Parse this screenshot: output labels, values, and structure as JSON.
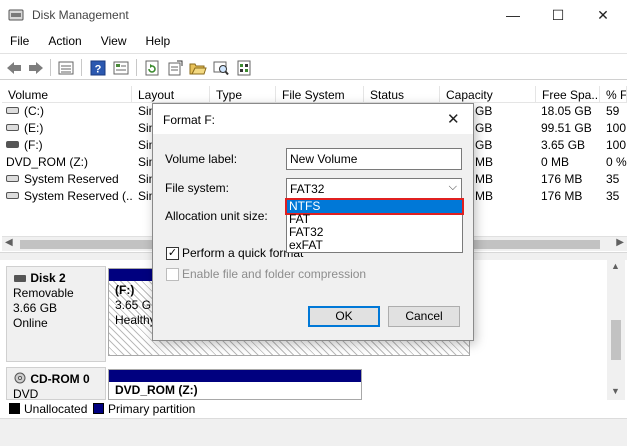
{
  "window": {
    "title": "Disk Management",
    "minimize_glyph": "—",
    "maximize_glyph": "☐",
    "close_glyph": "✕"
  },
  "menu": [
    "File",
    "Action",
    "View",
    "Help"
  ],
  "toolbar_icons": [
    "back-arrow-icon",
    "forward-arrow-icon",
    "disk-list-icon",
    "help-icon",
    "properties-icon",
    "refresh-icon",
    "rescan-icon",
    "open-folder-icon",
    "explore-icon",
    "settings-icon"
  ],
  "volume_list": {
    "columns": [
      "Volume",
      "Layout",
      "Type",
      "File System",
      "Status",
      "Capacity",
      "Free Spa...",
      "% F"
    ],
    "rows": [
      {
        "volume": "(C:)",
        "layout": "Sim",
        "capacity": "GB",
        "free": "18.05 GB",
        "pct": "59"
      },
      {
        "volume": "(E:)",
        "layout": "Sim",
        "capacity": "GB",
        "free": "99.51 GB",
        "pct": "100"
      },
      {
        "volume": "(F:)",
        "layout": "Sim",
        "capacity": "GB",
        "free": "3.65 GB",
        "pct": "100"
      },
      {
        "volume": "DVD_ROM (Z:)",
        "layout": "Sim",
        "capacity": "MB",
        "free": "0 MB",
        "pct": "0 %"
      },
      {
        "volume": "System Reserved",
        "layout": "Sim",
        "capacity": "MB",
        "free": "176 MB",
        "pct": "35"
      },
      {
        "volume": "System Reserved (...",
        "layout": "Sim",
        "capacity": "MB",
        "free": "176 MB",
        "pct": "35"
      }
    ]
  },
  "disks": [
    {
      "name": "Disk 2",
      "type": "Removable",
      "size": "3.66 GB",
      "status": "Online",
      "partition": {
        "label": "(F:)",
        "line2": "3.65 GB",
        "line3": "Healthy"
      }
    },
    {
      "name": "CD-ROM 0",
      "type": "DVD",
      "partition": {
        "label": "DVD_ROM  (Z:)"
      }
    }
  ],
  "legend": [
    {
      "label": "Unallocated",
      "color": "#000000"
    },
    {
      "label": "Primary partition",
      "color": "#00007f"
    }
  ],
  "dialog": {
    "title": "Format F:",
    "volume_label_caption": "Volume label:",
    "volume_label_value": "New Volume",
    "file_system_caption": "File system:",
    "file_system_value": "FAT32",
    "allocation_caption": "Allocation unit size:",
    "options": [
      "NTFS",
      "FAT",
      "FAT32",
      "exFAT"
    ],
    "highlighted_option": "NTFS",
    "quick_format_label": "Perform a quick format",
    "quick_format_checked": true,
    "compression_label": "Enable file and folder compression",
    "ok_label": "OK",
    "cancel_label": "Cancel"
  },
  "colors": {
    "accent": "#0078d7",
    "highlight_border": "#e02020",
    "partition_bar": "#00007f"
  }
}
